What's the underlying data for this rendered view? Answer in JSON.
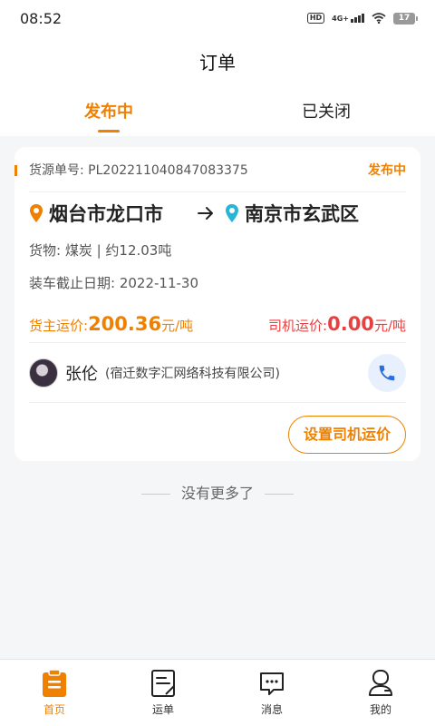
{
  "status_bar": {
    "time": "08:52",
    "hd": "HD",
    "network": "4G+",
    "battery": "17"
  },
  "page_title": "订单",
  "tabs": [
    {
      "label": "发布中",
      "active": true
    },
    {
      "label": "已关闭",
      "active": false
    }
  ],
  "order": {
    "order_no_label": "货源单号:",
    "order_no": "PL202211040847083375",
    "status": "发布中",
    "from_city": "烟台市龙口市",
    "to_city": "南京市玄武区",
    "cargo_text": "货物:   煤炭 | 约12.03吨",
    "deadline_text": "装车截止日期:  2022-11-30",
    "owner_price_label": "货主运价:",
    "owner_price": "200.36",
    "owner_price_unit": "元/吨",
    "driver_price_label": "司机运价:",
    "driver_price": "0.00",
    "driver_price_unit": "元/吨",
    "driver_name": "张伦",
    "driver_company": "(宿迁数字汇网络科技有限公司)",
    "set_price_button": "设置司机运价"
  },
  "no_more_text": "没有更多了",
  "bottom_nav": [
    {
      "label": "首页",
      "icon": "home-clipboard-icon",
      "active": true
    },
    {
      "label": "运单",
      "icon": "waybill-icon",
      "active": false
    },
    {
      "label": "消息",
      "icon": "message-icon",
      "active": false
    },
    {
      "label": "我的",
      "icon": "profile-icon",
      "active": false
    }
  ],
  "colors": {
    "accent": "#f08000",
    "driver_price": "#e84040",
    "origin_pin": "#f08000",
    "dest_pin": "#29b6d6",
    "call": "#2a6fe0"
  }
}
